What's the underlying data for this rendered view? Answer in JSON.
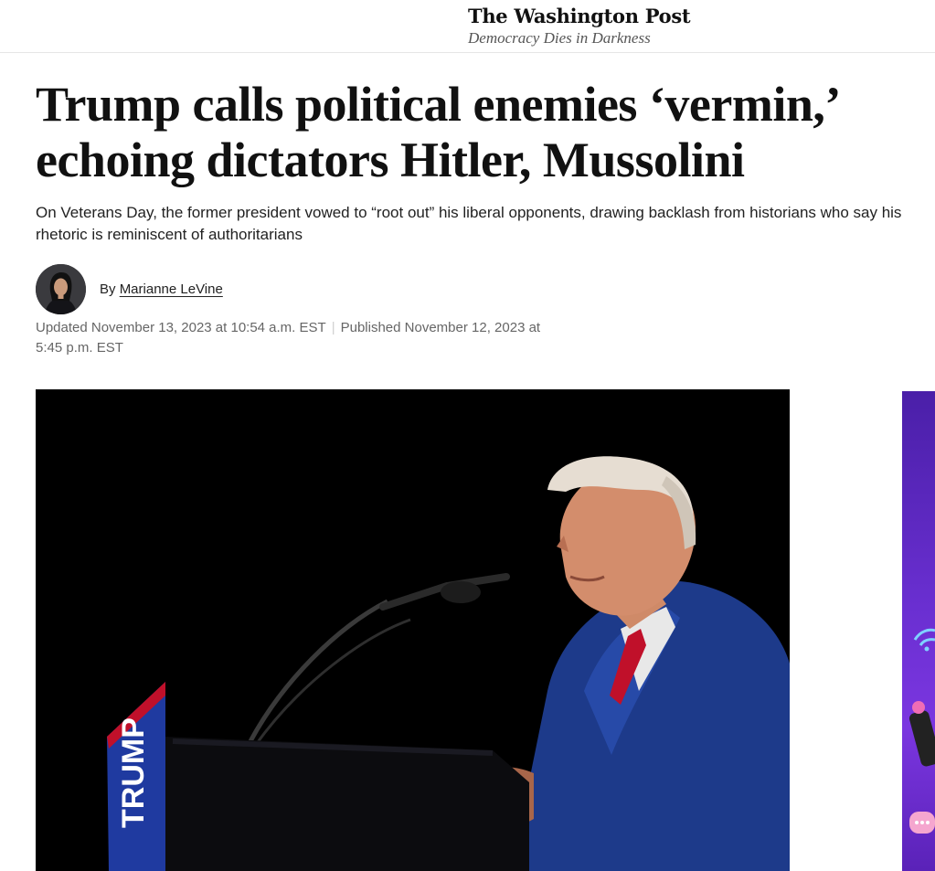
{
  "masthead": {
    "logo": "The Washington Post",
    "tagline": "Democracy Dies in Darkness"
  },
  "article": {
    "headline": "Trump calls political enemies ‘vermin,’ echoing dictators Hitler, Mussolini",
    "subheadline": "On Veterans Day, the former president vowed to “root out” his liberal opponents, drawing backlash from historians who say his rhetoric is reminiscent of authoritarians",
    "byline": {
      "prefix": "By",
      "author": "Marianne LeVine"
    },
    "dates": {
      "updated": "Updated November 13, 2023 at 10:54 a.m. EST",
      "separator": "|",
      "published": "Published November 12, 2023 at 5:45 p.m. EST"
    },
    "hero_image": {
      "podium_sign_text": "TRUMP",
      "icon": "speaker-at-podium"
    }
  },
  "colors": {
    "text": "#111111",
    "muted": "#666666",
    "hero_background": "#000000",
    "suit_blue": "#1f3a8a",
    "tie_red": "#c0102a",
    "sign_blue": "#1f3aa0",
    "ad_purple": "#6a2fd1"
  }
}
